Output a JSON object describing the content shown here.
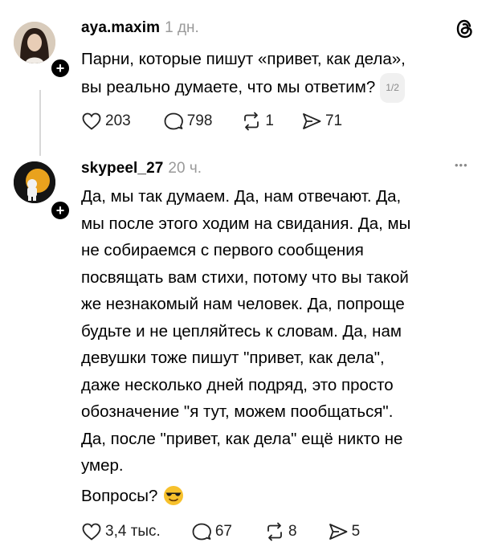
{
  "post": {
    "username": "aya.maxim",
    "time": "1 дн.",
    "text_line1": "Парни, которые пишут «привет, как дела»,",
    "text_line2": "вы реально думаете, что мы ответим?",
    "pager": "1/2",
    "likes": "203",
    "comments": "798",
    "reposts": "1",
    "shares": "71"
  },
  "reply": {
    "username": "skypeel_27",
    "time": "20 ч.",
    "more": "•••",
    "lines": [
      "Да, мы так думаем. Да, нам отвечают. Да,",
      "мы после этого ходим на свидания. Да, мы",
      "не собираемся с первого сообщения",
      "посвящать вам стихи, потому что вы такой",
      "же незнакомый нам человек. Да, попроще",
      "будьте и не цепляйтесь к словам. Да, нам",
      "девушки тоже пишут \"привет, как дела\",",
      "даже несколько дней подряд, это просто",
      "обозначение \"я тут, можем пообщаться\".",
      "Да, после \"привет, как дела\" ещё никто не",
      "умер."
    ],
    "last_line": "Вопросы?",
    "likes": "3,4 тыс.",
    "comments": "67",
    "reposts": "8",
    "shares": "5"
  },
  "icons": {
    "post_avatar": "avatar-photo",
    "reply_avatar": "astronaut-avatar",
    "app_logo": "threads-logo-icon",
    "emoji": "sunglasses-emoji"
  }
}
